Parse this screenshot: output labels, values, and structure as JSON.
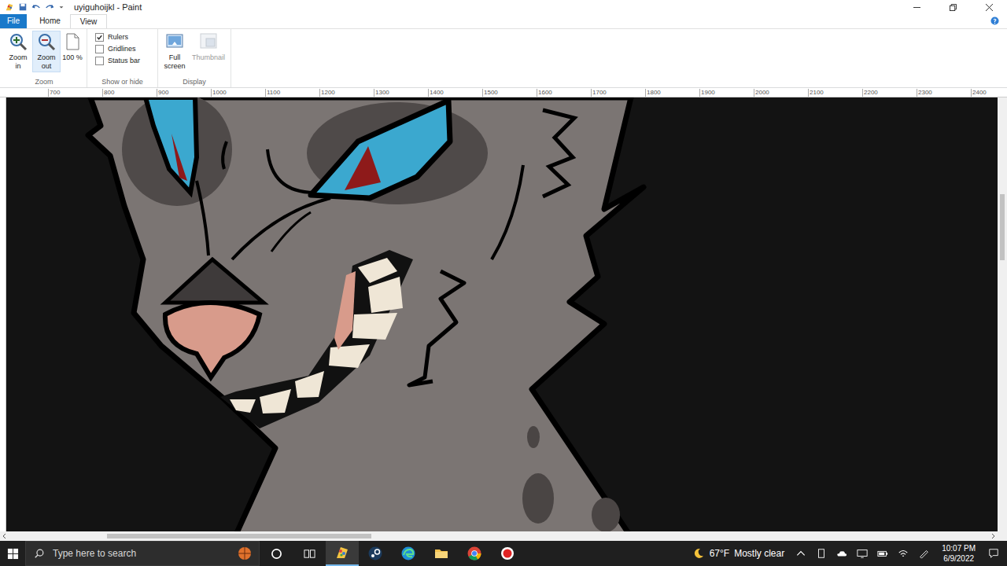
{
  "window": {
    "title": "uyiguhoijkl - Paint"
  },
  "tabs": [
    {
      "label": "File",
      "kind": "menu",
      "selected": false
    },
    {
      "label": "Home",
      "kind": "tab",
      "selected": false
    },
    {
      "label": "View",
      "kind": "tab",
      "selected": true
    }
  ],
  "ribbon": {
    "zoom": {
      "label": "Zoom",
      "zoom_in": {
        "label": "Zoom in",
        "hovered": false,
        "disabled": false
      },
      "zoom_out": {
        "label": "Zoom out",
        "hovered": true,
        "disabled": false
      },
      "actual_size": {
        "label": "100 %",
        "hovered": false,
        "disabled": false
      }
    },
    "show_or_hide": {
      "label": "Show or hide",
      "options": [
        {
          "label": "Rulers",
          "checked": true
        },
        {
          "label": "Gridlines",
          "checked": false
        },
        {
          "label": "Status bar",
          "checked": false
        }
      ]
    },
    "display": {
      "label": "Display",
      "full_screen": {
        "label": "Full screen",
        "disabled": false
      },
      "thumbnail": {
        "label": "Thumbnail",
        "disabled": true
      }
    }
  },
  "ruler": {
    "horizontal": [
      "700",
      "800",
      "900",
      "1000",
      "1100",
      "1200",
      "1300",
      "1400",
      "1500",
      "1600",
      "1700",
      "1800",
      "1900",
      "2000",
      "2100",
      "2200",
      "2300",
      "2400"
    ]
  },
  "scrollbars": {
    "horizontal": {
      "offset": 0.1,
      "level": 0.27
    },
    "vertical": {
      "offset": 0.21,
      "level": 0.16
    }
  },
  "taskbar": {
    "search": {
      "placeholder": "Type here to search"
    },
    "apps": [
      {
        "active": true
      },
      {
        "active": false
      },
      {
        "active": false
      },
      {
        "active": false
      },
      {
        "active": false
      },
      {
        "active": false
      }
    ],
    "weather": {
      "temperature": "67°F",
      "condition": "Mostly clear"
    },
    "clock": {
      "time": "10:07 PM",
      "date": "6/9/2022"
    }
  }
}
